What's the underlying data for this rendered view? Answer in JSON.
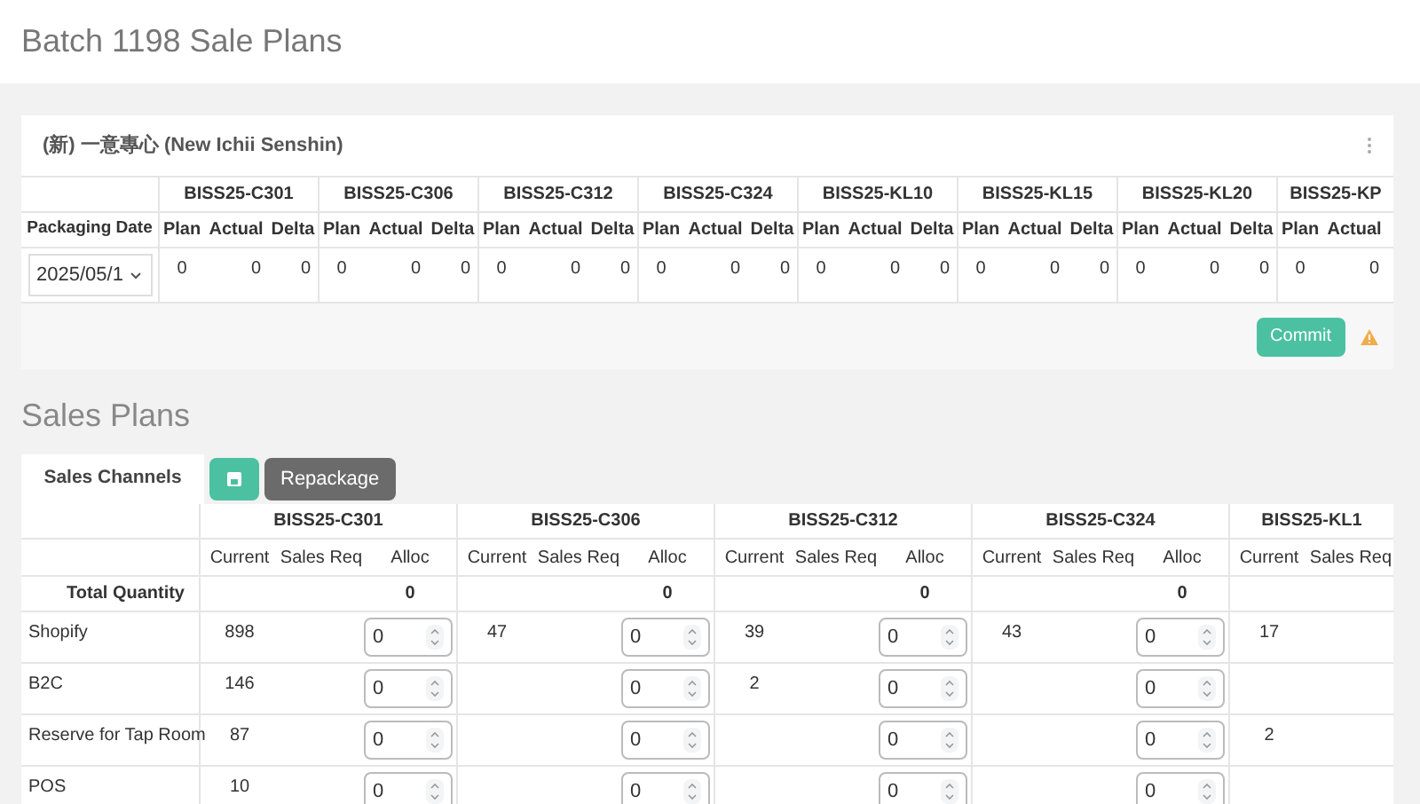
{
  "page_title": "Batch 1198 Sale Plans",
  "packaging_card": {
    "title": "(新) 一意專心 (New Ichii Senshin)",
    "date_label": "Packaging Date",
    "date_value": "2025/05/1",
    "products": [
      {
        "name": "BISS25-C301",
        "columns": [
          "Plan",
          "Actual",
          "Delta"
        ],
        "values": [
          "0",
          "0",
          "0"
        ]
      },
      {
        "name": "BISS25-C306",
        "columns": [
          "Plan",
          "Actual",
          "Delta"
        ],
        "values": [
          "0",
          "0",
          "0"
        ]
      },
      {
        "name": "BISS25-C312",
        "columns": [
          "Plan",
          "Actual",
          "Delta"
        ],
        "values": [
          "0",
          "0",
          "0"
        ]
      },
      {
        "name": "BISS25-C324",
        "columns": [
          "Plan",
          "Actual",
          "Delta"
        ],
        "values": [
          "0",
          "0",
          "0"
        ]
      },
      {
        "name": "BISS25-KL10",
        "columns": [
          "Plan",
          "Actual",
          "Delta"
        ],
        "values": [
          "0",
          "0",
          "0"
        ]
      },
      {
        "name": "BISS25-KL15",
        "columns": [
          "Plan",
          "Actual",
          "Delta"
        ],
        "values": [
          "0",
          "0",
          "0"
        ]
      },
      {
        "name": "BISS25-KL20",
        "columns": [
          "Plan",
          "Actual",
          "Delta"
        ],
        "values": [
          "0",
          "0",
          "0"
        ]
      },
      {
        "name": "BISS25-KP",
        "columns": [
          "Plan",
          "Actual"
        ],
        "values": [
          "0",
          "0"
        ]
      }
    ],
    "commit_label": "Commit",
    "warning": true
  },
  "sales_section": {
    "title": "Sales Plans",
    "tab": "Sales Channels",
    "repackage_label": "Repackage",
    "total_label": "Total Quantity",
    "channels": [
      "Shopify",
      "B2C",
      "Reserve for Tap Room",
      "POS"
    ],
    "products": [
      {
        "name": "BISS25-C301",
        "columns": [
          "Current",
          "Sales Req",
          "Alloc"
        ],
        "total": "0",
        "rows": [
          {
            "current": "898",
            "alloc": "0"
          },
          {
            "current": "146",
            "alloc": "0"
          },
          {
            "current": "87",
            "alloc": "0"
          },
          {
            "current": "10",
            "alloc": "0"
          }
        ]
      },
      {
        "name": "BISS25-C306",
        "columns": [
          "Current",
          "Sales Req",
          "Alloc"
        ],
        "total": "0",
        "rows": [
          {
            "current": "47",
            "alloc": "0"
          },
          {
            "alloc": "0"
          },
          {
            "alloc": "0"
          },
          {
            "alloc": "0"
          }
        ]
      },
      {
        "name": "BISS25-C312",
        "columns": [
          "Current",
          "Sales Req",
          "Alloc"
        ],
        "total": "0",
        "rows": [
          {
            "current": "39",
            "alloc": "0"
          },
          {
            "current": "2",
            "alloc": "0"
          },
          {
            "alloc": "0"
          },
          {
            "alloc": "0"
          }
        ]
      },
      {
        "name": "BISS25-C324",
        "columns": [
          "Current",
          "Sales Req",
          "Alloc"
        ],
        "total": "0",
        "rows": [
          {
            "current": "43",
            "alloc": "0"
          },
          {
            "alloc": "0"
          },
          {
            "alloc": "0"
          },
          {
            "alloc": "0"
          }
        ]
      },
      {
        "name": "BISS25-KL1",
        "columns": [
          "Current",
          "Sales Req"
        ],
        "rows": [
          {
            "current": "17"
          },
          {},
          {
            "current": "2"
          },
          {}
        ]
      }
    ]
  }
}
